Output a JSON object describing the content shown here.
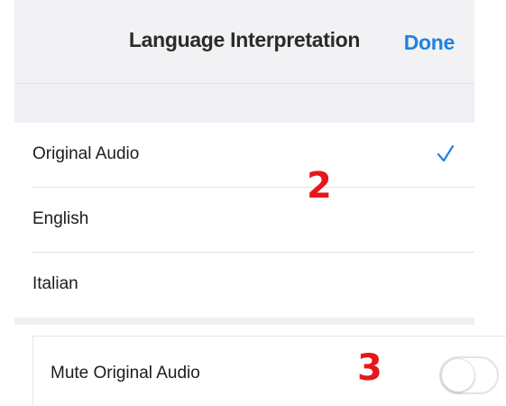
{
  "header": {
    "title": "Language Interpretation",
    "done_label": "Done"
  },
  "languages": [
    {
      "label": "Original Audio",
      "selected": true
    },
    {
      "label": "English",
      "selected": false
    },
    {
      "label": "Italian",
      "selected": false
    }
  ],
  "annotations": {
    "step_2": "2",
    "step_3": "3"
  },
  "mute": {
    "label": "Mute Original Audio",
    "enabled": false
  },
  "colors": {
    "accent": "#1e82e6",
    "annotation": "#e8161a",
    "background": "#f2f2f5"
  },
  "icons": {
    "selected_marker": "checkmark-icon"
  }
}
